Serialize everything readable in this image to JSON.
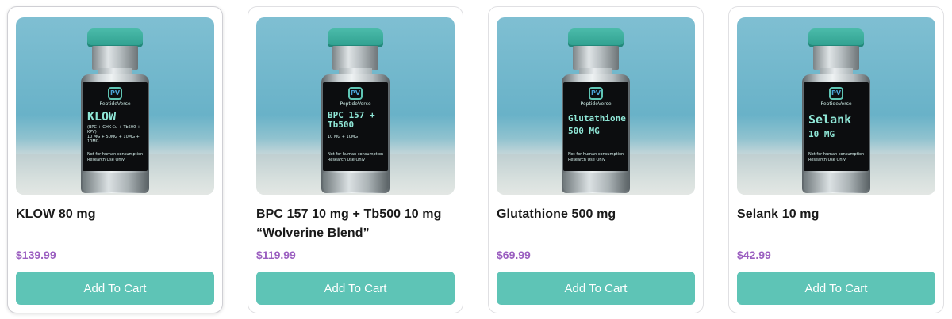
{
  "products": [
    {
      "name": "KLOW 80 mg",
      "price": "$139.99",
      "button_label": "Add To Cart",
      "vial": {
        "brand": "PeptideVerse",
        "name": "KLOW",
        "sub": "(BPC + GHK-Cu + Tb500 + KPV)",
        "dose": "10 MG + 50MG + 10MG + 10MG",
        "note1": "Not for human consumption",
        "note2": "Research Use Only"
      }
    },
    {
      "name": "BPC 157 10 mg + Tb500 10 mg “Wolverine Blend”",
      "price": "$119.99",
      "button_label": "Add To Cart",
      "vial": {
        "brand": "PeptideVerse",
        "name": "BPC 157 + Tb500",
        "sub": "",
        "dose": "10 MG + 10MG",
        "note1": "Not for human consumption",
        "note2": "Research Use Only"
      }
    },
    {
      "name": "Glutathione 500 mg",
      "price": "$69.99",
      "button_label": "Add To Cart",
      "vial": {
        "brand": "PeptideVerse",
        "name": "Glutathione",
        "sub": "",
        "dose": "500 MG",
        "note1": "Not for human consumption",
        "note2": "Research Use Only"
      }
    },
    {
      "name": "Selank 10 mg",
      "price": "$42.99",
      "button_label": "Add To Cart",
      "vial": {
        "brand": "PeptideVerse",
        "name": "Selank",
        "sub": "",
        "dose": "10 MG",
        "note1": "Not for human consumption",
        "note2": "Research Use Only"
      }
    }
  ],
  "colors": {
    "button": "#5ec4b6",
    "price": "#9b5fc0",
    "cap": "#3aae9e"
  },
  "icons": {
    "vial_logo": "pv-logo-icon"
  }
}
